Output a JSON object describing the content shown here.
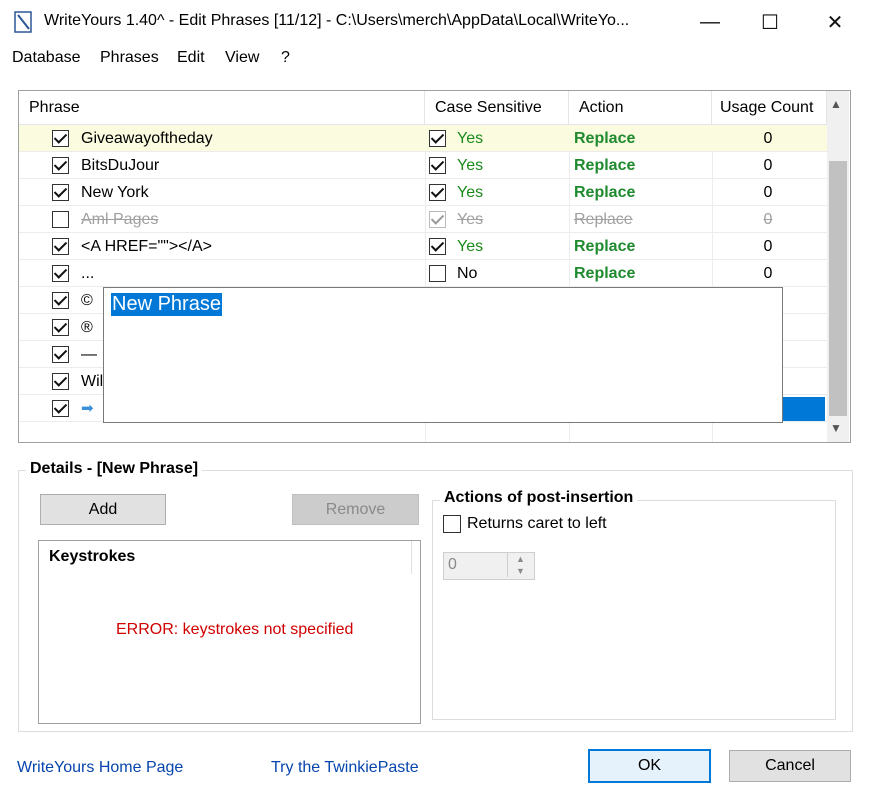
{
  "window": {
    "title": "WriteYours 1.40^ - Edit Phrases [11/12] - C:\\Users\\merch\\AppData\\Local\\WriteYo...",
    "minimize_glyph": "—",
    "maximize_glyph": "☐",
    "close_glyph": "✕"
  },
  "menu": [
    "Database",
    "Phrases",
    "Edit",
    "View",
    "?"
  ],
  "grid": {
    "headers": [
      "Phrase",
      "Case Sensitive",
      "Action",
      "Usage Count"
    ],
    "rows": [
      {
        "enabled": true,
        "phrase": "Giveawayoftheday",
        "case_checked": true,
        "case": "Yes",
        "action": "Replace",
        "usage": "0",
        "highlight": true
      },
      {
        "enabled": true,
        "phrase": "BitsDuJour",
        "case_checked": true,
        "case": "Yes",
        "action": "Replace",
        "usage": "0"
      },
      {
        "enabled": true,
        "phrase": "New York",
        "case_checked": true,
        "case": "Yes",
        "action": "Replace",
        "usage": "0"
      },
      {
        "enabled": false,
        "phrase": "Aml Pages",
        "case_checked": true,
        "case": "Yes",
        "action": "Replace",
        "usage": "0"
      },
      {
        "enabled": true,
        "phrase": "<A HREF=\"\"></A>",
        "case_checked": true,
        "case": "Yes",
        "action": "Replace",
        "usage": "0"
      },
      {
        "enabled": true,
        "phrase": "...",
        "case_checked": false,
        "case": "No",
        "action": "Replace",
        "usage": "0"
      },
      {
        "enabled": true,
        "phrase": "©"
      },
      {
        "enabled": true,
        "phrase": "®"
      },
      {
        "enabled": true,
        "phrase": "—"
      },
      {
        "enabled": true,
        "phrase": "Wil"
      },
      {
        "enabled": true,
        "phrase": "➡",
        "is_new": true
      }
    ],
    "editor_text": "New Phrase",
    "scroll_up": "▲",
    "scroll_down": "▼"
  },
  "details": {
    "title": "Details - [New Phrase]",
    "add_label": "Add",
    "remove_label": "Remove",
    "keystrokes_header": "Keystrokes",
    "error": "ERROR: keystrokes not specified",
    "actions_title": "Actions of post-insertion",
    "caret_label": "Returns caret to left",
    "caret_value": "0",
    "spin_up": "▲",
    "spin_down": "▼"
  },
  "footer": {
    "home_link": "WriteYours Home Page",
    "twinkie_link": "Try the TwinkiePaste",
    "ok_label": "OK",
    "cancel_label": "Cancel"
  },
  "colors": {
    "accent": "#0078d7",
    "yes_green": "#1a8a1a",
    "replace_green": "#1f8b2e",
    "error_red": "#d00000",
    "link_blue": "#0645ad",
    "row_highlight": "#fbfbe0"
  }
}
